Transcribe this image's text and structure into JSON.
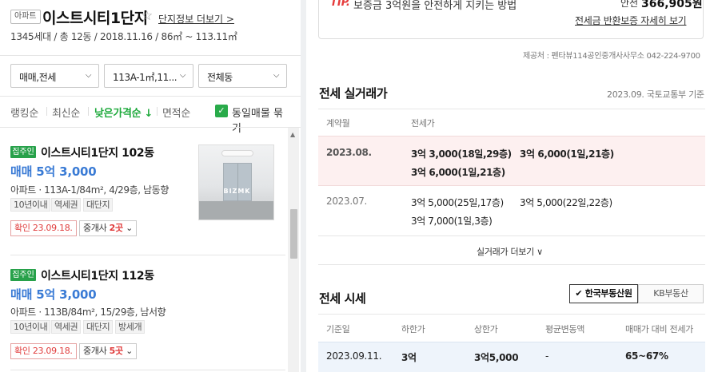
{
  "complex": {
    "type_badge": "아파트",
    "name": "이스트시티1단지",
    "star": "☆",
    "info_link": "단지정보 더보기 >",
    "meta": "1345세대 / 총 12동 / 2018.11.16 / 86㎡ ~ 113.11㎡"
  },
  "filters": [
    {
      "label": "매매,전세",
      "icon": "chevron-down-icon"
    },
    {
      "label": "113A-1㎡,11...",
      "icon": "chevron-down-icon"
    },
    {
      "label": "전체동",
      "icon": "chevron-down-icon"
    }
  ],
  "sort": {
    "items": [
      "랭킹순",
      "최신순",
      "낮은가격순 ↓",
      "면적순"
    ],
    "active_index": 2,
    "group_checkbox_label": "동일매물 묶기",
    "group_checked": true
  },
  "listings": [
    {
      "badge": "집주인",
      "title": "이스트시티1단지 102동",
      "price": "매매 5억 3,000",
      "spec": "아파트 · 113A-1/84m², 4/29층, 남동향",
      "tags": [
        "10년이내",
        "역세권",
        "대단지"
      ],
      "confirmed": "확인 23.09.18.",
      "agents_prefix": "중개사 ",
      "agents_count": "2곳",
      "photo_watermark": "BIZMK"
    },
    {
      "badge": "집주인",
      "title": "이스트시티1단지 112동",
      "price": "매매 5억 3,000",
      "spec": "아파트 · 113B/84m², 15/29층, 남서향",
      "tags": [
        "10년이내",
        "역세권",
        "대단지",
        "방세개"
      ],
      "confirmed": "확인 23.09.18.",
      "agents_prefix": "중개사 ",
      "agents_count": "5곳"
    }
  ],
  "tip": {
    "label": "TIP.",
    "text": "보증금 3억원을 안전하게 지키는 방법",
    "amount_label": "안전",
    "amount": "366,905원",
    "link": "전세금 반환보증 자세히 보기"
  },
  "source": "제공처 : 펜타뷰114공인중개사사무소 042-224-9700",
  "jeonse_deals": {
    "title": "전세 실거래가",
    "note": "2023.09. 국토교통부 기준",
    "headers": [
      "계약월",
      "전세가"
    ],
    "rows": [
      {
        "month": "2023.08.",
        "deals": [
          "3억 3,000(18일,29층)",
          "3억 6,000(1일,21층)",
          "3억 6,000(1일,21층)"
        ]
      },
      {
        "month": "2023.07.",
        "deals": [
          "3억 5,000(25일,17층)",
          "3억 5,000(22일,22층)",
          "3억 7,000(1일,3층)"
        ]
      }
    ],
    "more": "실거래가 더보기 ∨"
  },
  "jeonse_market": {
    "title": "전세 시세",
    "sources": [
      "✔ 한국부동산원",
      "KB부동산"
    ],
    "active_source": 0,
    "headers": [
      "기준일",
      "하한가",
      "상한가",
      "평균변동액",
      "매매가 대비 전세가"
    ],
    "row": [
      "2023.09.11.",
      "3억",
      "3억5,000",
      "-",
      "65~67%"
    ]
  }
}
